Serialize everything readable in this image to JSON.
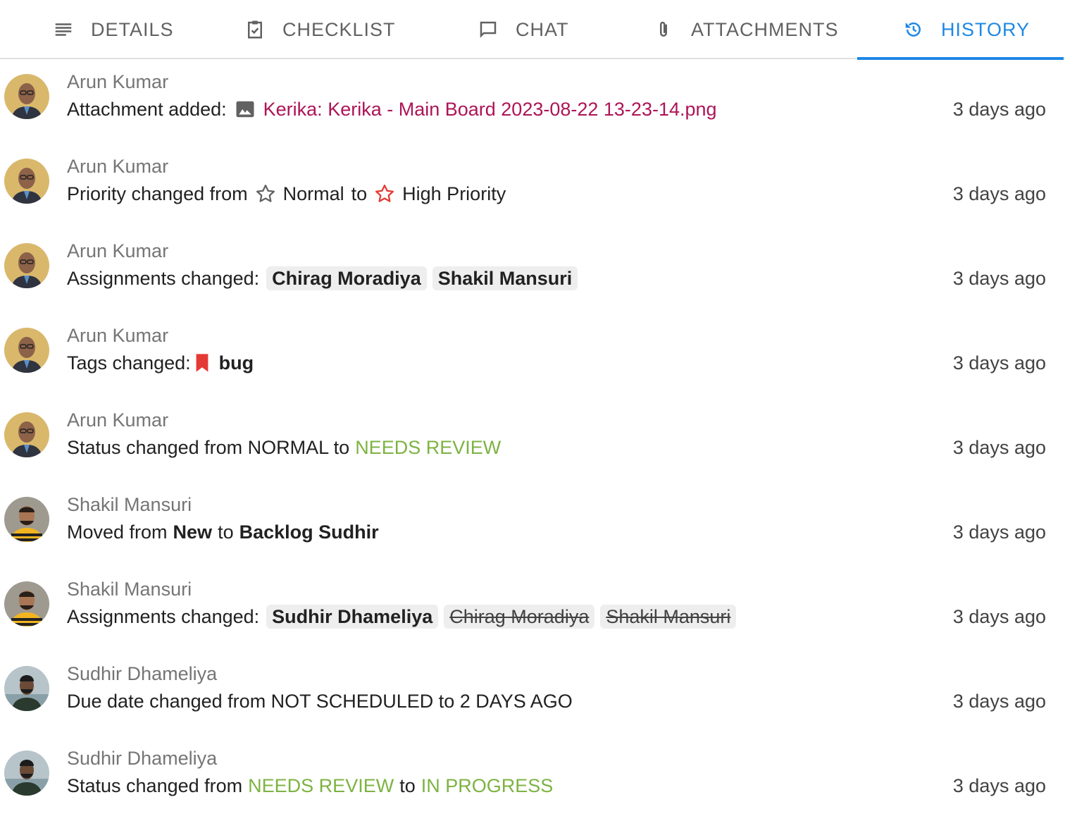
{
  "tabs": [
    {
      "label": "DETAILS",
      "icon": "details-icon"
    },
    {
      "label": "CHECKLIST",
      "icon": "checklist-icon"
    },
    {
      "label": "CHAT",
      "icon": "chat-icon"
    },
    {
      "label": "ATTACHMENTS",
      "icon": "attachment-icon"
    },
    {
      "label": "HISTORY",
      "icon": "history-icon",
      "active": true
    }
  ],
  "colors": {
    "accent": "#1e88e5",
    "status_green": "#7cb342",
    "link": "#ad1457",
    "priority_star": "#e53935",
    "tag_bug": "#e53935"
  },
  "history": [
    {
      "author": "Arun Kumar",
      "time": "3 days ago",
      "prefix": "Attachment added:",
      "file_name": "Kerika: Kerika - Main Board 2023-08-22 13-23-14.png"
    },
    {
      "author": "Arun Kumar",
      "time": "3 days ago",
      "prefix": "Priority changed from",
      "from": "Normal",
      "to_word": "to",
      "to": "High Priority"
    },
    {
      "author": "Arun Kumar",
      "time": "3 days ago",
      "prefix": "Assignments changed:",
      "chips": [
        "Chirag Moradiya",
        "Shakil Mansuri"
      ]
    },
    {
      "author": "Arun Kumar",
      "time": "3 days ago",
      "prefix": "Tags changed:",
      "tag": "bug"
    },
    {
      "author": "Arun Kumar",
      "time": "3 days ago",
      "prefix": "Status changed from NORMAL to",
      "status": "NEEDS REVIEW"
    },
    {
      "author": "Shakil Mansuri",
      "time": "3 days ago",
      "w1": "Moved from",
      "from": "New",
      "w2": "to",
      "to": "Backlog Sudhir"
    },
    {
      "author": "Shakil Mansuri",
      "time": "3 days ago",
      "prefix": "Assignments changed:",
      "added": "Sudhir Dhameliya",
      "removed": [
        "Chirag Moradiya",
        "Shakil Mansuri"
      ]
    },
    {
      "author": "Sudhir Dhameliya",
      "time": "3 days ago",
      "text": "Due date changed from NOT SCHEDULED to 2 DAYS AGO"
    },
    {
      "author": "Sudhir Dhameliya",
      "time": "3 days ago",
      "prefix": "Status changed from",
      "from_status": "NEEDS REVIEW",
      "to_word": "to",
      "to_status": "IN PROGRESS"
    }
  ]
}
